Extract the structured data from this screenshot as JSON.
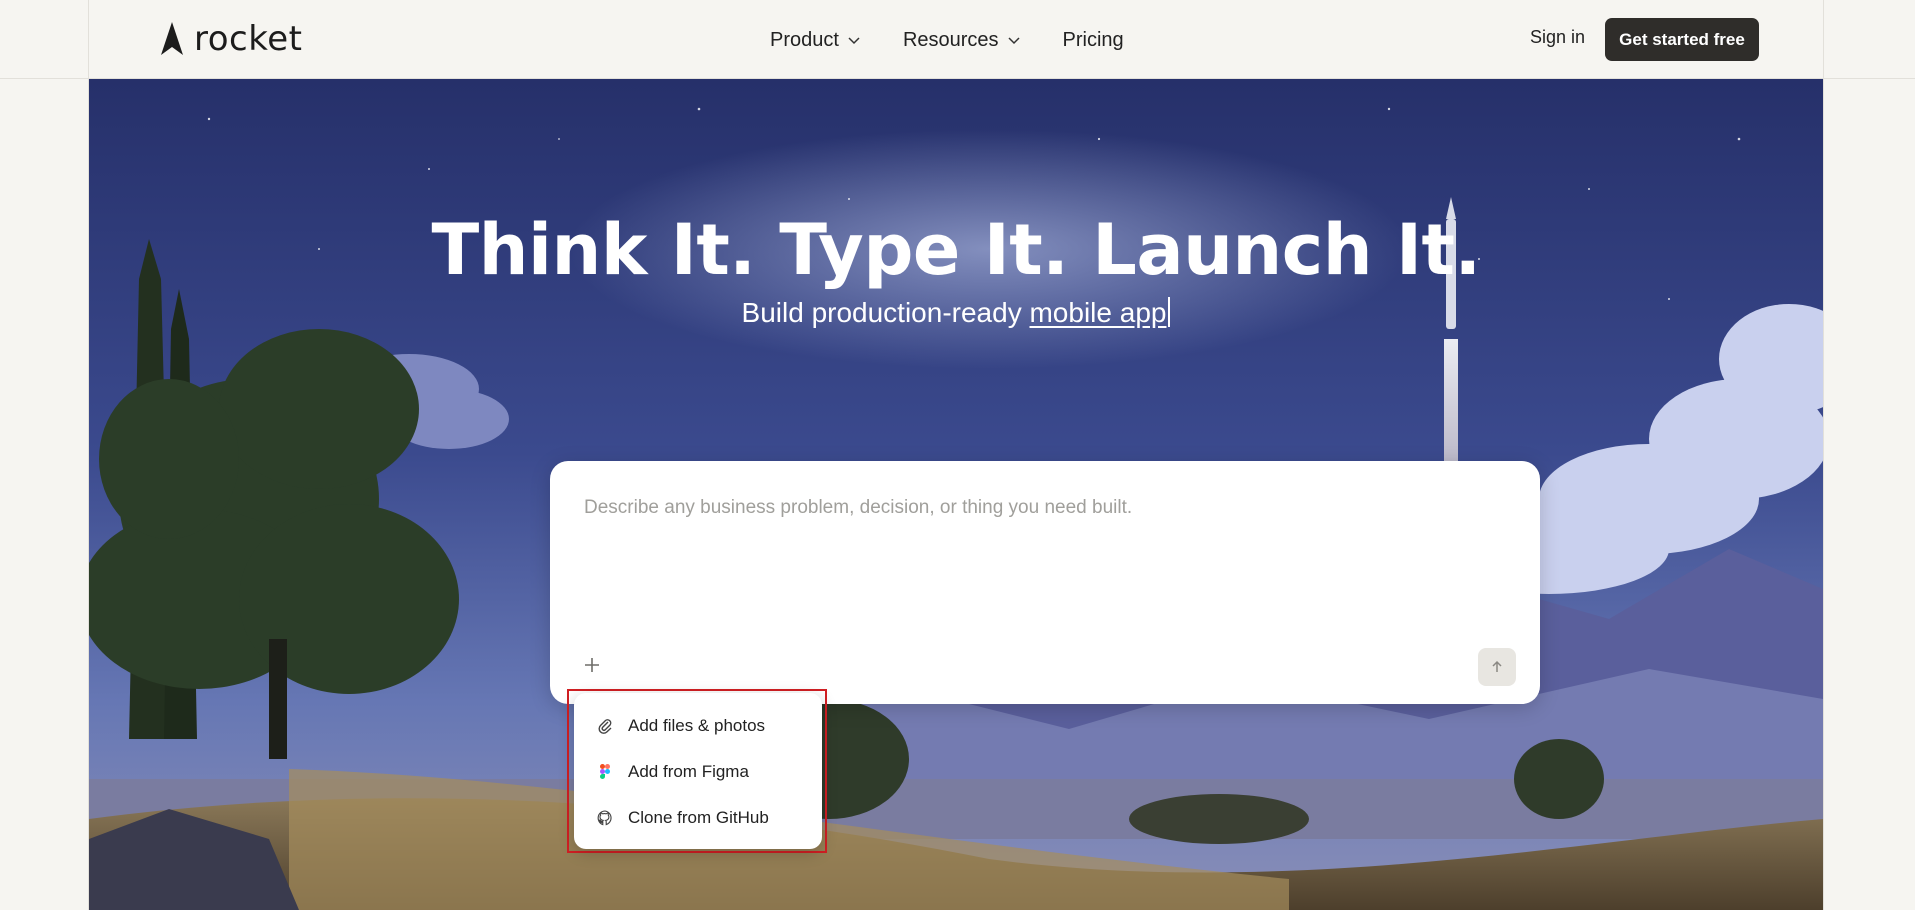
{
  "brand": {
    "name": "rocket",
    "logo_icon": "rocket-logo-icon"
  },
  "nav": {
    "items": [
      {
        "label": "Product",
        "has_dropdown": true
      },
      {
        "label": "Resources",
        "has_dropdown": true
      },
      {
        "label": "Pricing",
        "has_dropdown": false
      }
    ],
    "sign_in": "Sign in",
    "cta": "Get started free"
  },
  "hero": {
    "headline": "Think It. Type It. Launch It.",
    "subline_prefix": "Build production-ready ",
    "subline_typed": "mobile app"
  },
  "prompt": {
    "placeholder": "Describe any business problem, decision, or thing you need built.",
    "add_icon": "plus-icon",
    "send_icon": "arrow-up-icon"
  },
  "attach_menu": {
    "items": [
      {
        "label": "Add files & photos",
        "icon": "paperclip-icon"
      },
      {
        "label": "Add from Figma",
        "icon": "figma-icon"
      },
      {
        "label": "Clone from GitHub",
        "icon": "github-icon"
      }
    ]
  },
  "colors": {
    "page_bg": "#f6f5f1",
    "cta_bg": "#2f2d2a",
    "highlight": "#d11f23",
    "sky_top": "#2b356f",
    "sky_bottom": "#5a6eb0"
  }
}
